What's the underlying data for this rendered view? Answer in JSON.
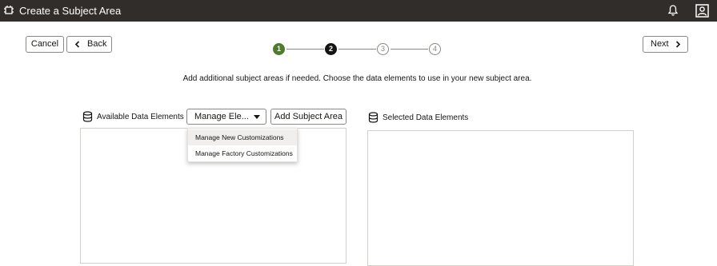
{
  "header": {
    "title": "Create a Subject Area",
    "app_icon": "subject-area-icon",
    "notification_icon": "bell-icon",
    "user_icon": "user-avatar-icon",
    "bg_color": "#312d2a"
  },
  "nav": {
    "cancel_label": "Cancel",
    "back_label": "Back",
    "next_label": "Next"
  },
  "train": {
    "steps": [
      {
        "number": "1",
        "state": "complete"
      },
      {
        "number": "2",
        "state": "current"
      },
      {
        "number": "3",
        "state": "pending"
      },
      {
        "number": "4",
        "state": "pending"
      }
    ],
    "complete_color": "#4e7b2c"
  },
  "instructions": "Add additional subject areas if needed. Choose the data elements to use in your new subject area.",
  "available": {
    "label": "Available Data Elements",
    "manage_dropdown_label": "Manage Ele...",
    "add_subject_area_label": "Add Subject Area"
  },
  "manage_menu": {
    "items": [
      {
        "label": "Manage New Customizations",
        "highlighted": true
      },
      {
        "label": "Manage Factory Customizations",
        "highlighted": false
      }
    ]
  },
  "selected": {
    "label": "Selected Data Elements"
  }
}
